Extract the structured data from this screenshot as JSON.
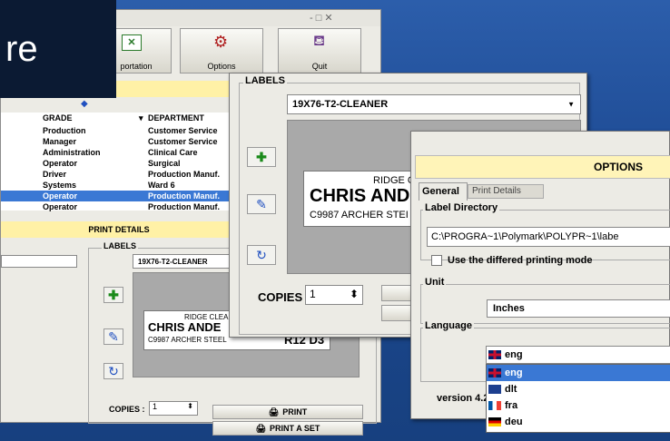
{
  "caption": "re",
  "toolbar": {
    "btn1_label": "portation",
    "btn2_label": "Options",
    "btn3_label": "Quit",
    "window_controls": "- □ ✕"
  },
  "grid": {
    "columns": [
      "GRADE",
      "DEPARTMENT"
    ],
    "rows": [
      {
        "grade": "Production",
        "dept": "Customer Service"
      },
      {
        "grade": "Manager",
        "dept": "Customer Service"
      },
      {
        "grade": "Administration",
        "dept": "Clinical Care"
      },
      {
        "grade": "Operator",
        "dept": "Surgical"
      },
      {
        "grade": "Driver",
        "dept": "Production Manuf."
      },
      {
        "grade": "Systems",
        "dept": "Ward 6"
      },
      {
        "grade": "Operator",
        "dept": "Production Manuf."
      },
      {
        "grade": "Operator",
        "dept": "Production Manuf."
      }
    ],
    "selected_row": 6
  },
  "print_details": "PRINT DETAILS",
  "back_labels": {
    "group": "LABELS",
    "combo_value": "19X76-T2-CLEANER",
    "label_line1": "RIDGE CLEAN",
    "label_line2": "CHRIS ANDE",
    "label_line3": "C9987  ARCHER STEEL",
    "label_code": "R12  D3",
    "copies_label": "COPIES :",
    "copies_value": "1",
    "print_btn": "PRINT",
    "print_set_btn": "PRINT A SET"
  },
  "front_labels": {
    "group": "LABELS",
    "combo_value": "19X76-T2-CLEANER",
    "label_line1": "RIDGE CLEANEI",
    "label_line2": "CHRIS ANDER",
    "label_line3": "C9987  ARCHER STEI",
    "copies_label": "COPIES :",
    "copies_value": "1"
  },
  "options": {
    "title": "OPTIONS",
    "tabs": [
      "General",
      "Print Details"
    ],
    "label_directory_group": "Label Directory",
    "label_directory_value": "C:\\PROGRA~1\\Polymark\\POLYPR~1\\labe",
    "differed_checkbox": "Use the differed printing mode",
    "unit_group": "Unit",
    "unit_value": "Inches",
    "language_group": "Language",
    "language_value": "eng",
    "language_options": [
      "eng",
      "dlt",
      "fra",
      "deu"
    ],
    "language_selected": 0,
    "version": "version 4.2"
  },
  "colors": {
    "desktop": "#1f4f9a",
    "caption_bg": "#0b1a33",
    "selection": "#3a78d4",
    "highlight": "#fff1a6"
  }
}
